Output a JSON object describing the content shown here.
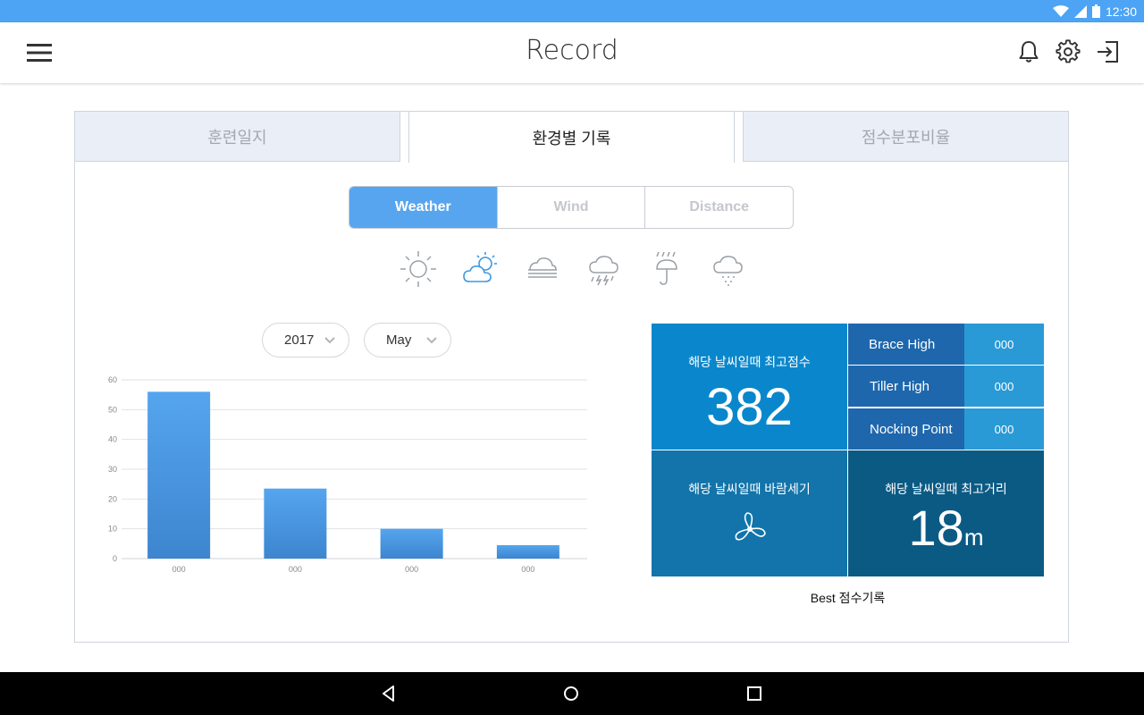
{
  "status_bar": {
    "time": "12:30"
  },
  "app_bar": {
    "title": "Record",
    "icons": [
      "menu-icon",
      "bell-icon",
      "gear-icon",
      "sign-in-icon"
    ]
  },
  "tabs": [
    {
      "label": "훈련일지",
      "active": false
    },
    {
      "label": "환경별 기록",
      "active": true
    },
    {
      "label": "점수분포비율",
      "active": false
    }
  ],
  "segments": [
    {
      "label": "Weather",
      "active": true
    },
    {
      "label": "Wind",
      "active": false
    },
    {
      "label": "Distance",
      "active": false
    }
  ],
  "weather_icons": [
    {
      "name": "sunny-icon",
      "selected": false
    },
    {
      "name": "partly-cloudy-icon",
      "selected": true
    },
    {
      "name": "fog-icon",
      "selected": false
    },
    {
      "name": "thunderstorm-icon",
      "selected": false
    },
    {
      "name": "rain-umbrella-icon",
      "selected": false
    },
    {
      "name": "snow-cloud-icon",
      "selected": false
    }
  ],
  "filters": {
    "year": "2017",
    "month": "May"
  },
  "chart_data": {
    "type": "bar",
    "categories": [
      "000",
      "000",
      "000",
      "000"
    ],
    "values": [
      56,
      23.5,
      10,
      4.5
    ],
    "yticks": [
      "0",
      "10",
      "20",
      "30",
      "40",
      "50",
      "60"
    ],
    "ylim": [
      0,
      60
    ],
    "grid": true,
    "bar_color": "#4c9ce6"
  },
  "best": {
    "top_score_label": "해당 날씨일때 최고점수",
    "top_score_value": "382",
    "rows": [
      {
        "label": "Brace High",
        "value": "000"
      },
      {
        "label": "Tiller High",
        "value": "000"
      },
      {
        "label": "Nocking Point",
        "value": "000"
      }
    ],
    "wind_label": "해당 날씨일때 바람세기",
    "distance_label": "해당 날씨일때 최고거리",
    "distance_value": "18",
    "distance_unit": "m",
    "caption": "Best 점수기록"
  },
  "colors": {
    "status_bar": "#4da3f4",
    "accent": "#57a5ef",
    "score_cell": "#0a87cc",
    "label_cell": "#1e67ad",
    "value_cell": "#2a9ad6",
    "wind_cell": "#1274aa",
    "distance_cell": "#0b5a84"
  }
}
